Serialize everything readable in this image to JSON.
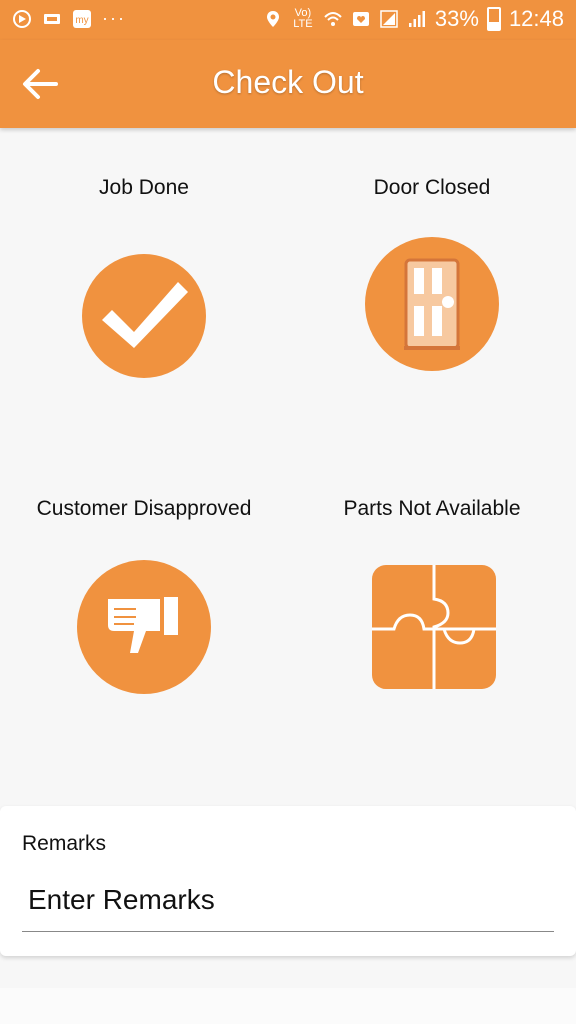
{
  "status_bar": {
    "battery": "33%",
    "time": "12:48",
    "network": "Vo) LTE",
    "left_icons": [
      "app-icon",
      "sim-icon",
      "my-app-icon"
    ],
    "right_icons": [
      "location-icon",
      "volte-icon",
      "wifi-icon",
      "notification-icon",
      "signal-icon",
      "battery-icon"
    ]
  },
  "header": {
    "title": "Check Out",
    "back_icon": "back-arrow-icon"
  },
  "options": [
    {
      "label": "Job Done",
      "icon": "checkmark-icon"
    },
    {
      "label": "Door Closed",
      "icon": "door-icon"
    },
    {
      "label": "Customer Disapproved",
      "icon": "thumbs-down-icon"
    },
    {
      "label": "Parts Not Available",
      "icon": "puzzle-icon"
    }
  ],
  "remarks": {
    "label": "Remarks",
    "placeholder": "Enter Remarks"
  },
  "colors": {
    "accent": "#f0923f",
    "background": "#f7f7f7"
  }
}
